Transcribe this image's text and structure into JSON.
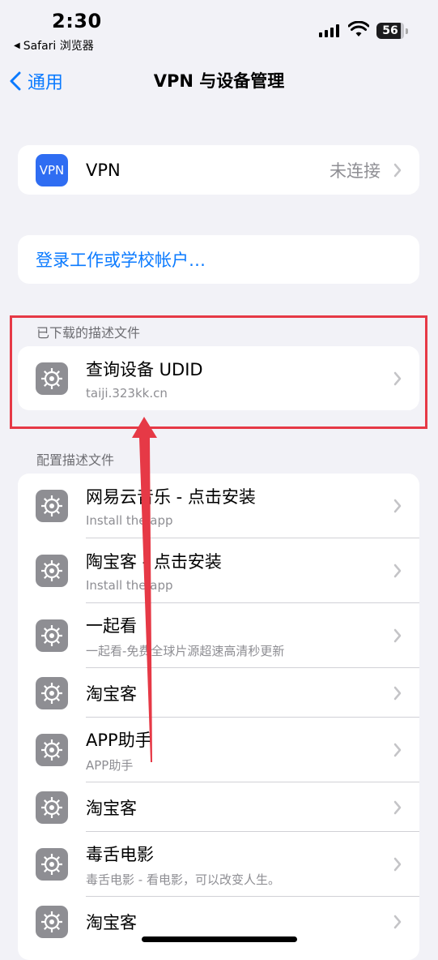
{
  "status_bar": {
    "time": "2:30",
    "back_app": "Safari 浏览器",
    "battery": "56"
  },
  "nav": {
    "back_label": "通用",
    "title": "VPN 与设备管理"
  },
  "vpn_row": {
    "icon_text": "VPN",
    "label": "VPN",
    "status": "未连接"
  },
  "sign_in": {
    "label": "登录工作或学校帐户…"
  },
  "downloaded": {
    "header": "已下载的描述文件",
    "items": [
      {
        "title": "查询设备 UDID",
        "subtitle": "taiji.323kk.cn"
      }
    ]
  },
  "profiles": {
    "header": "配置描述文件",
    "items": [
      {
        "title": "网易云音乐 - 点击安装",
        "subtitle": "Install the app"
      },
      {
        "title": "陶宝客 - 点击安装",
        "subtitle": "Install the app"
      },
      {
        "title": "一起看",
        "subtitle": "一起看-免费全球片源超速高清秒更新"
      },
      {
        "title": "淘宝客",
        "subtitle": ""
      },
      {
        "title": "APP助手",
        "subtitle": "APP助手"
      },
      {
        "title": "淘宝客",
        "subtitle": ""
      },
      {
        "title": "毒舌电影",
        "subtitle": "毒舌电影 - 看电影，可以改变人生。"
      },
      {
        "title": "淘宝客",
        "subtitle": ""
      }
    ]
  },
  "colors": {
    "accent": "#0a7aff",
    "annotation": "#e63946",
    "background": "#f2f2f7"
  }
}
